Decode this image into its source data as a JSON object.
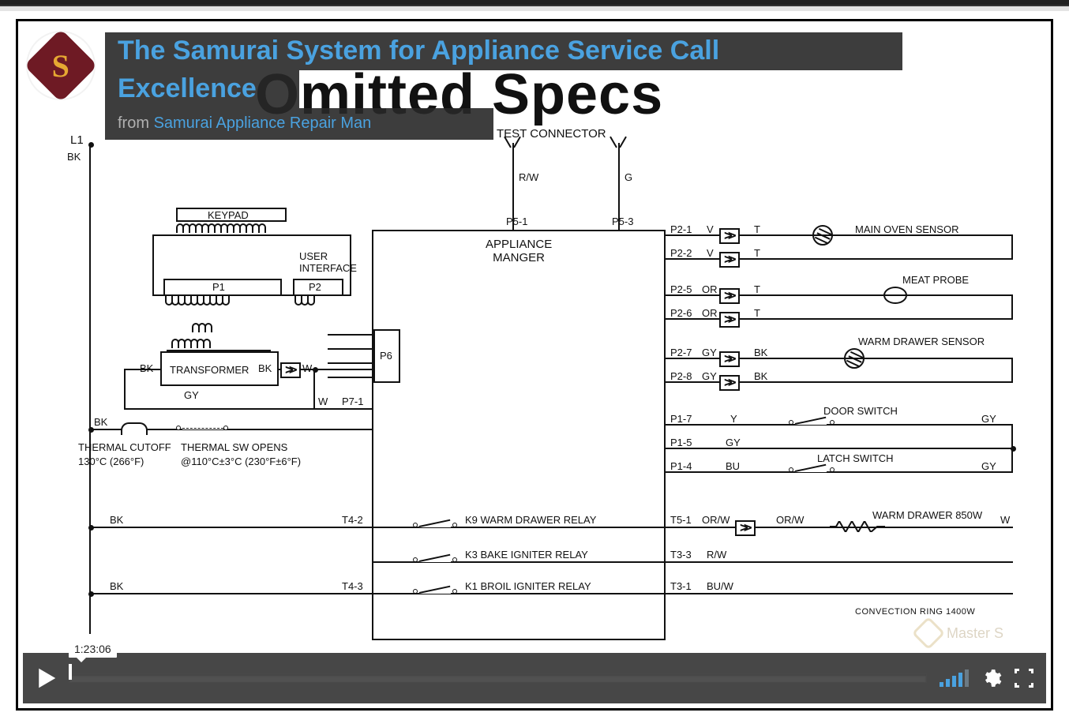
{
  "header": {
    "title_line1": "The Samurai System for Appliance Service Call",
    "title_line2": "Excellence",
    "from_label": "from ",
    "author": "Samurai Appliance Repair Man"
  },
  "background_title": "Omitted Specs",
  "schematic": {
    "l1": "L1",
    "l1_color": "BK",
    "test_connector": "TEST CONNECTOR",
    "tc_rw": "R/W",
    "tc_g": "G",
    "p5_1": "P5-1",
    "p5_3": "P5-3",
    "keypad": "KEYPAD",
    "user_interface": "USER\nINTERFACE",
    "p1": "P1",
    "p2": "P2",
    "p6": "P6",
    "transformer": "TRANSFORMER",
    "trans_bk_l": "BK",
    "trans_bk_r": "BK",
    "trans_gy": "GY",
    "trans_w1": "W",
    "trans_w2": "W",
    "p7_1": "P7-1",
    "appliance_manager": "APPLIANCE\nMANGER",
    "thermal_bk": "BK",
    "thermal_cutoff_l1": "THERMAL CUTOFF",
    "thermal_cutoff_l2": "130°C (266°F)",
    "thermal_sw_l1": "THERMAL SW OPENS",
    "thermal_sw_l2": "@110°C±3°C (230°F±6°F)",
    "right": {
      "p2_1": {
        "pin": "P2-1",
        "a": "V",
        "b": "T"
      },
      "p2_2": {
        "pin": "P2-2",
        "a": "V",
        "b": "T"
      },
      "main_oven_sensor": "MAIN OVEN SENSOR",
      "p2_5": {
        "pin": "P2-5",
        "a": "OR",
        "b": "T"
      },
      "p2_6": {
        "pin": "P2-6",
        "a": "OR",
        "b": "T"
      },
      "meat_probe": "MEAT PROBE",
      "p2_7": {
        "pin": "P2-7",
        "a": "GY",
        "b": "BK"
      },
      "p2_8": {
        "pin": "P2-8",
        "a": "GY",
        "b": "BK"
      },
      "warm_drawer_sensor": "WARM DRAWER SENSOR",
      "p1_7": {
        "pin": "P1-7",
        "a": "Y",
        "sw": "DOOR SWITCH",
        "end": "GY"
      },
      "p1_5": {
        "pin": "P1-5",
        "a": "GY"
      },
      "p1_4": {
        "pin": "P1-4",
        "a": "BU",
        "sw": "LATCH SWITCH",
        "end": "GY"
      }
    },
    "relays": {
      "row1_bk": "BK",
      "row1_t4_2": "T4-2",
      "k9": "K9 WARM DRAWER RELAY",
      "row1_t5_1": "T5-1",
      "row1_orw_a": "OR/W",
      "row1_orw_b": "OR/W",
      "warm_drawer_850w": "WARM DRAWER 850W",
      "row1_w": "W",
      "k3": "K3 BAKE IGNITER RELAY",
      "row2_t3_3": "T3-3",
      "row2_rw": "R/W",
      "row3_bk": "BK",
      "row3_t4_3": "T4-3",
      "k1": "K1 BROIL IGNITER RELAY",
      "row3_t3_1": "T3-1",
      "row3_buw": "BU/W",
      "convection": "CONVECTION RING 1400W"
    }
  },
  "player": {
    "time": "1:23:06"
  },
  "watermark": "Master S"
}
